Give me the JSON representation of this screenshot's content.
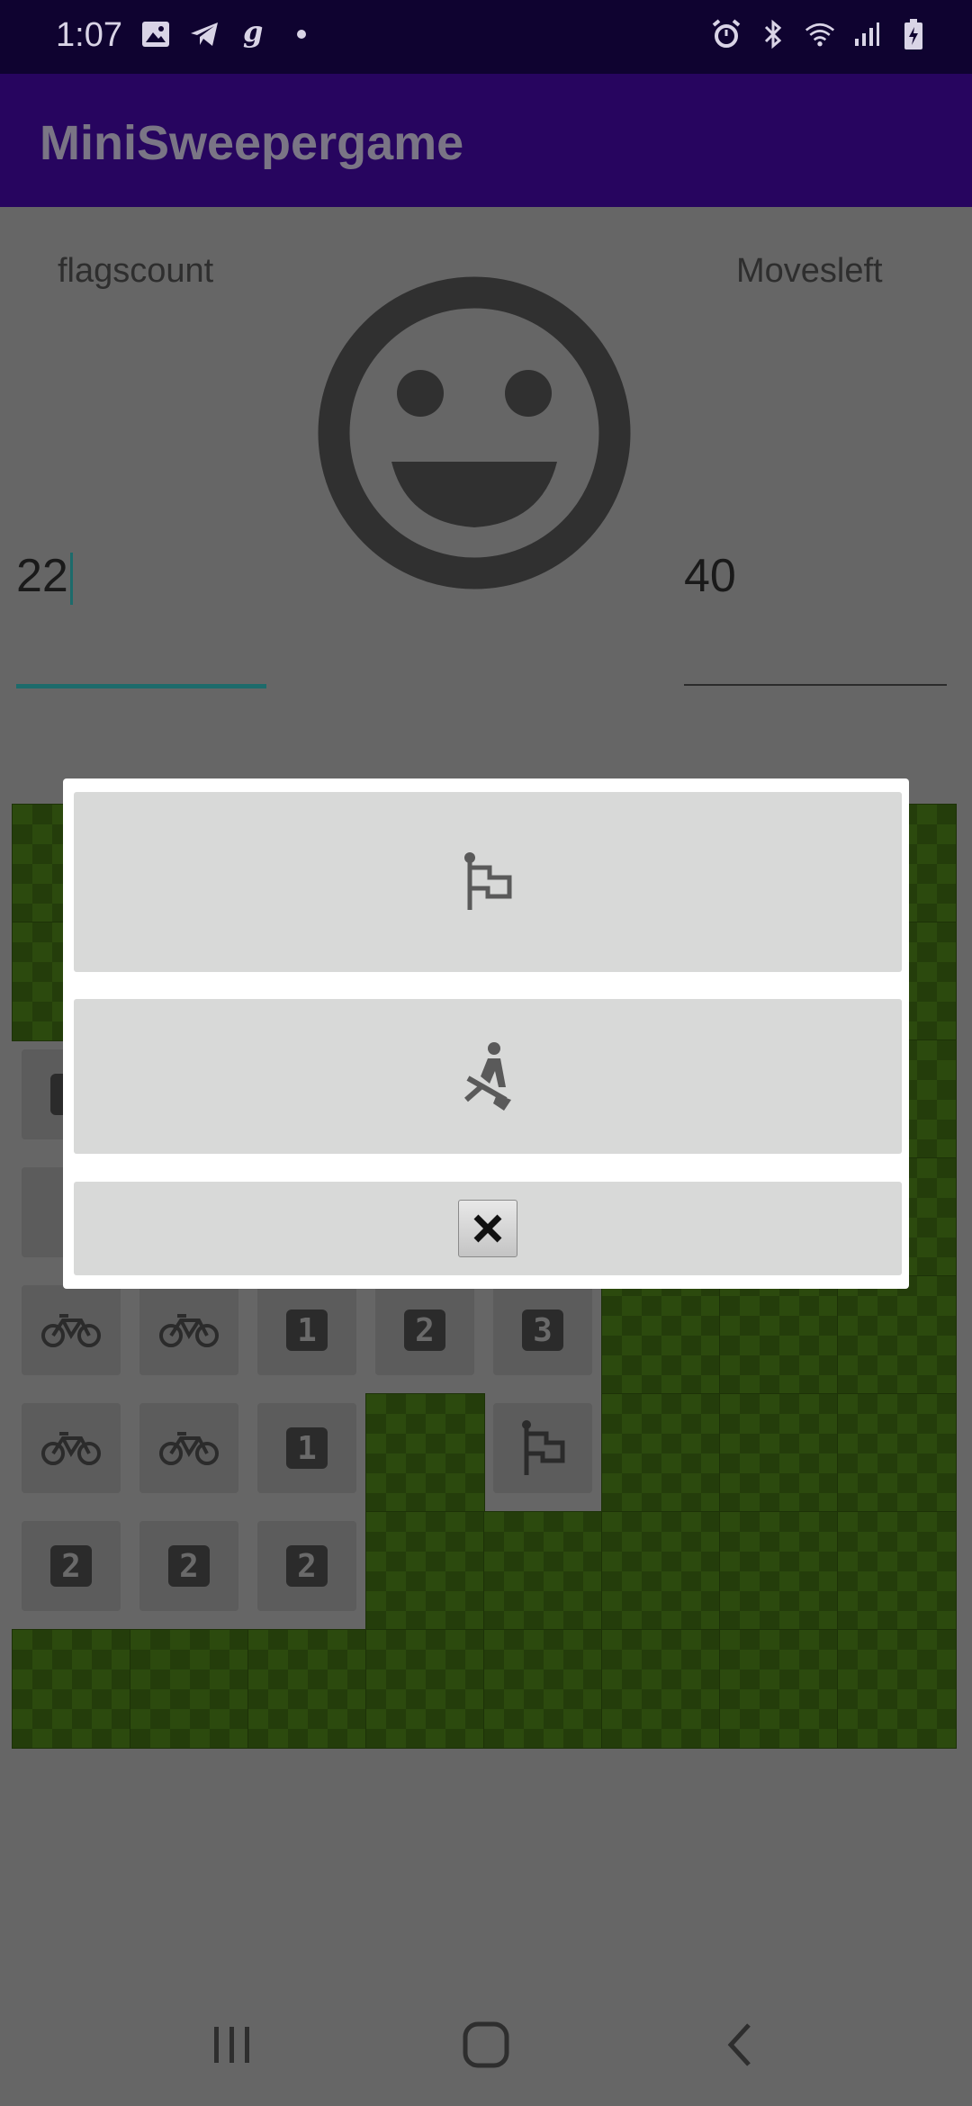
{
  "status_bar": {
    "time": "1:07",
    "left_icons": [
      "image-icon",
      "telegram-icon",
      "g-icon",
      "dot-icon"
    ],
    "right_icons": [
      "alarm-icon",
      "bluetooth-icon",
      "wifi-icon",
      "signal-icon",
      "battery-icon"
    ]
  },
  "app_bar": {
    "title": "MiniSweepergame"
  },
  "stats": {
    "flags_label": "flagscount",
    "moves_label": "Movesleft",
    "flags_value": "22",
    "moves_value": "40"
  },
  "board": {
    "revealed_cells": [
      {
        "content": "bike"
      },
      {
        "content": "bike"
      },
      {
        "content": "1"
      },
      {
        "content": "2"
      },
      {
        "content": "3"
      },
      {
        "content": "bike"
      },
      {
        "content": "bike"
      },
      {
        "content": "1"
      },
      {
        "content": "flag"
      },
      {
        "content": "2"
      },
      {
        "content": "2"
      },
      {
        "content": "2"
      }
    ]
  },
  "dialog": {
    "flag_button": "flag-icon",
    "dig_button": "dig-icon",
    "close_button": "close-icon"
  },
  "colors": {
    "status_bar": "#0f0330",
    "app_bar": "#27055f",
    "accent": "#1d6b6b",
    "grass": "#2c4a0e"
  }
}
